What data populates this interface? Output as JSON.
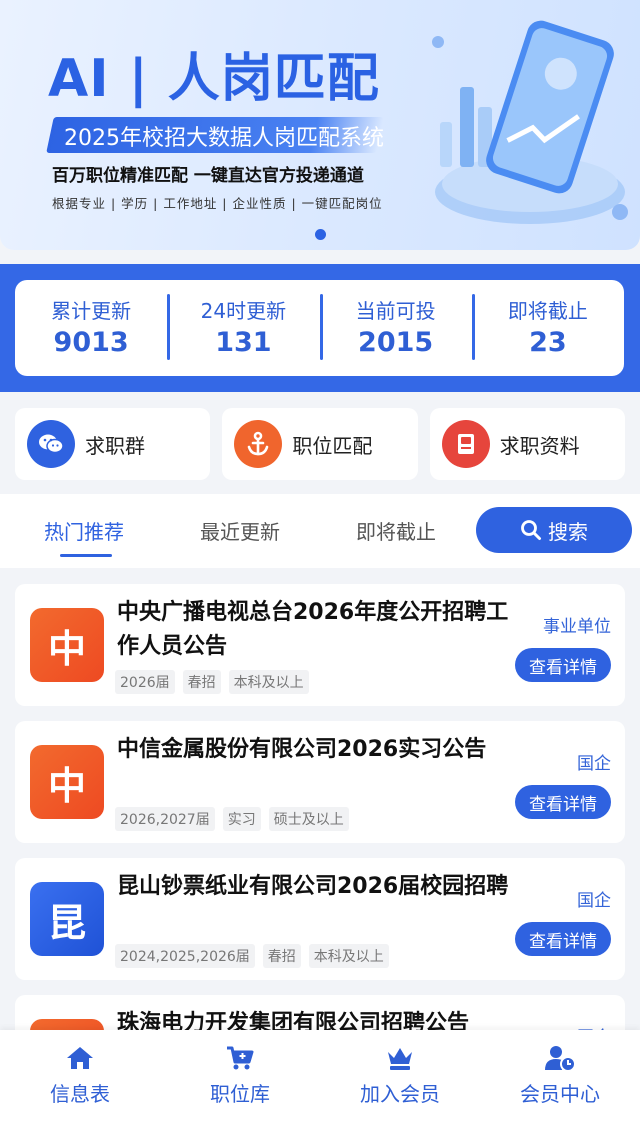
{
  "banner": {
    "title": "AI | 人岗匹配",
    "subtitle": "2025年校招大数据人岗匹配系统",
    "tagline": "百万职位精准匹配 一键直达官方投递通道",
    "features": "根据专业 | 学历 | 工作地址 | 企业性质 | 一键匹配岗位"
  },
  "stats": [
    {
      "label": "累计更新",
      "value": "9013"
    },
    {
      "label": "24时更新",
      "value": "131"
    },
    {
      "label": "当前可投",
      "value": "2015"
    },
    {
      "label": "即将截止",
      "value": "23"
    }
  ],
  "shortcuts": [
    {
      "label": "求职群",
      "icon": "chat-icon",
      "color": "#2f62e0"
    },
    {
      "label": "职位匹配",
      "icon": "anchor-icon",
      "color": "#f0652d"
    },
    {
      "label": "求职资料",
      "icon": "book-icon",
      "color": "#e6453c"
    }
  ],
  "tabs": {
    "hot": "热门推荐",
    "recent": "最近更新",
    "closing": "即将截止",
    "search": "搜索"
  },
  "jobs": [
    {
      "logo": "中",
      "logo_color": "#f05a28",
      "title": "中央广播电视总台2026年度公开招聘工作人员公告",
      "tags": [
        "2026届",
        "春招",
        "本科及以上"
      ],
      "type": "事业单位",
      "button": "查看详情"
    },
    {
      "logo": "中",
      "logo_color": "#f05a28",
      "title": "中信金属股份有限公司2026实习公告",
      "tags": [
        "2026,2027届",
        "实习",
        "硕士及以上"
      ],
      "type": "国企",
      "button": "查看详情"
    },
    {
      "logo": "昆",
      "logo_color": "#2a5fe6",
      "title": "昆山钞票纸业有限公司2026届校园招聘",
      "tags": [
        "2024,2025,2026届",
        "春招",
        "本科及以上"
      ],
      "type": "国企",
      "button": "查看详情"
    },
    {
      "logo": "",
      "logo_color": "#f05a28",
      "title": "珠海电力开发集团有限公司招聘公告",
      "tags": [],
      "type": "国企",
      "button": ""
    }
  ],
  "nav": [
    {
      "label": "信息表",
      "icon": "home-icon"
    },
    {
      "label": "职位库",
      "icon": "cart-icon"
    },
    {
      "label": "加入会员",
      "icon": "crown-icon"
    },
    {
      "label": "会员中心",
      "icon": "user-clock-icon"
    }
  ]
}
